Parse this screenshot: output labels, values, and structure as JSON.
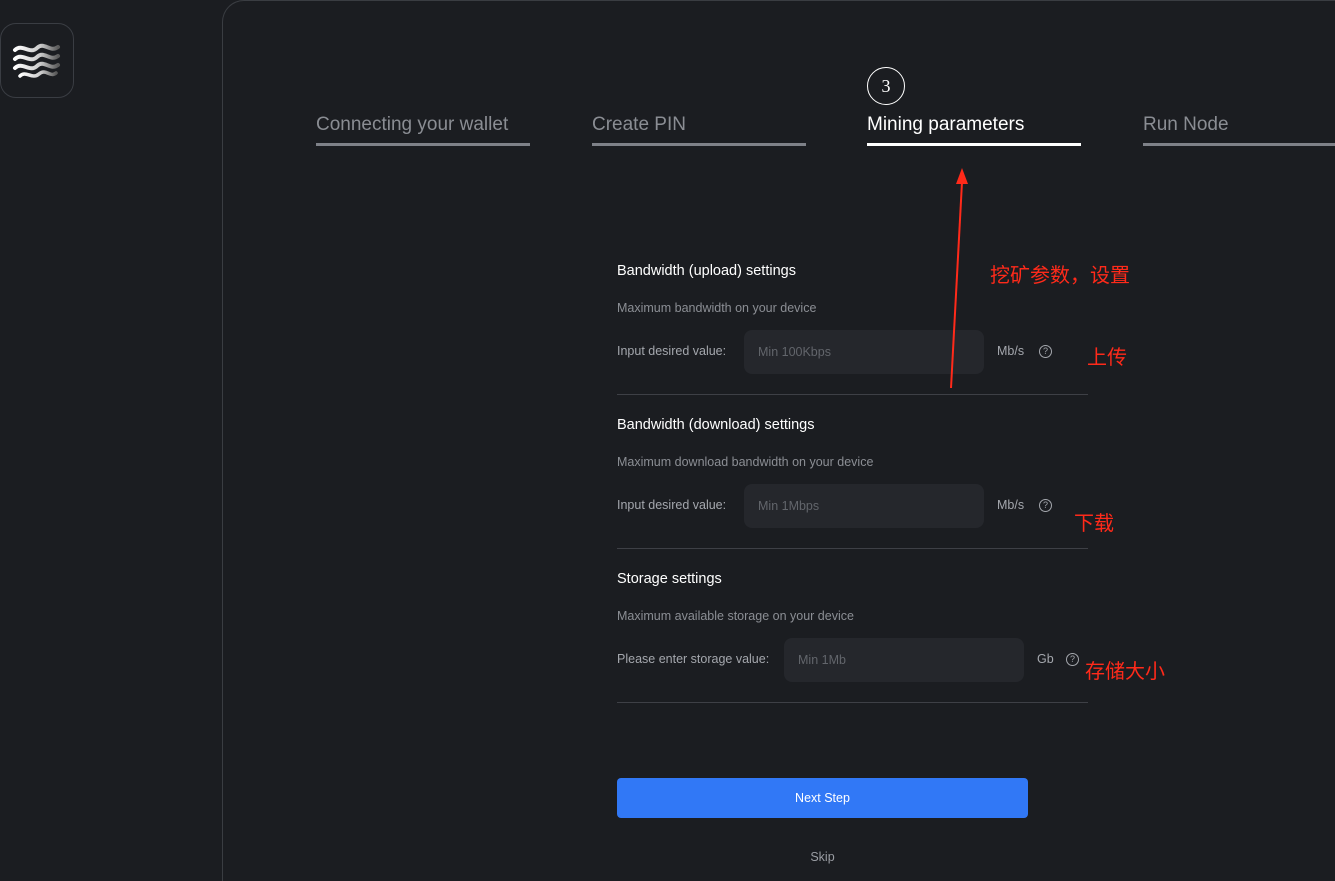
{
  "steps": [
    {
      "label": "Connecting your wallet"
    },
    {
      "label": "Create PIN"
    },
    {
      "label": "Mining parameters",
      "number": "3"
    },
    {
      "label": "Run Node"
    }
  ],
  "active_step_index": 2,
  "sections": {
    "upload": {
      "title": "Bandwidth (upload) settings",
      "subtitle": "Maximum bandwidth on your device",
      "input_label": "Input desired value:",
      "placeholder": "Min 100Kbps",
      "unit": "Mb/s"
    },
    "download": {
      "title": "Bandwidth (download) settings",
      "subtitle": "Maximum download bandwidth on your device",
      "input_label": "Input desired value:",
      "placeholder": "Min 1Mbps",
      "unit": "Mb/s"
    },
    "storage": {
      "title": "Storage settings",
      "subtitle": "Maximum available storage on your device",
      "input_label": "Please enter storage value:",
      "placeholder": "Min 1Mb",
      "unit": "Gb"
    }
  },
  "help_glyph": "?",
  "buttons": {
    "next": "Next Step",
    "skip": "Skip"
  },
  "annotations": {
    "mining_params": "挖矿参数，设置",
    "upload": "上传",
    "download": "下载",
    "storage": "存储大小"
  },
  "colors": {
    "background": "#1b1d21",
    "accent": "#3178f6",
    "annotation": "#ff2a1a"
  }
}
